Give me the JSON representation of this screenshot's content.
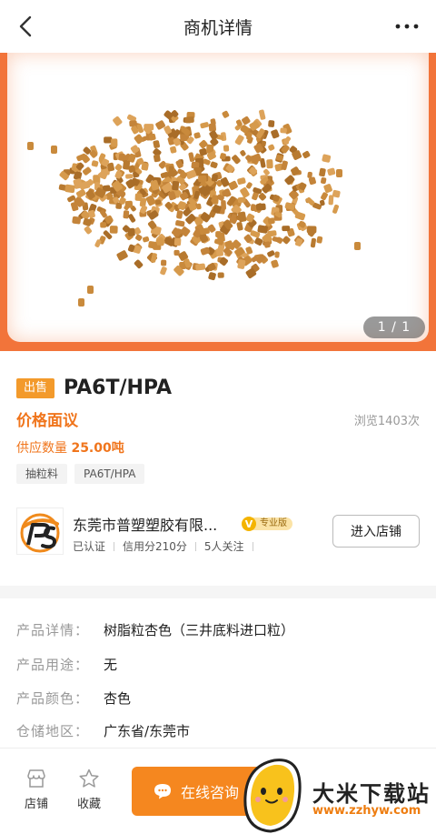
{
  "nav": {
    "title": "商机详情",
    "back_icon": "chevron-left-icon",
    "more_icon": "more-dots-icon"
  },
  "gallery": {
    "counter": "1 / 1",
    "accent": "#f2743a"
  },
  "product": {
    "sell_tag": "出售",
    "name": "PA6T/HPA",
    "price": "价格面议",
    "views": "浏览1403次",
    "supply_label": "供应数量",
    "supply_value": "25.00吨",
    "tags": [
      "抽粒料",
      "PA6T/HPA"
    ]
  },
  "shop": {
    "name": "东莞市普塑塑胶有限...",
    "badge_letter": "V",
    "badge_text": "专业版",
    "certified": "已认证",
    "credit": "信用分210分",
    "followers": "5人关注",
    "enter_label": "进入店铺"
  },
  "details": [
    {
      "key": "产品详情：",
      "value": "树脂粒杏色（三井底料进口粒）"
    },
    {
      "key": "产品用途：",
      "value": "无"
    },
    {
      "key": "产品颜色：",
      "value": "杏色"
    },
    {
      "key": "仓储地区：",
      "value": "广东省/东莞市"
    }
  ],
  "bottom": {
    "store_label": "店铺",
    "fav_label": "收藏",
    "consult_label": "在线咨询",
    "brand_color": "#f5871f"
  },
  "watermark": {
    "brand": "大米下载站",
    "url": "www.zzhyw.com"
  }
}
